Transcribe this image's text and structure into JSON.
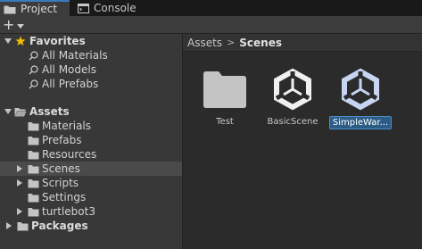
{
  "tabs": [
    {
      "label": "Project",
      "icon": "folder-icon",
      "active": true
    },
    {
      "label": "Console",
      "icon": "console-icon",
      "active": false
    }
  ],
  "toolbar": {
    "add_label": "+"
  },
  "tree": {
    "favorites": {
      "label": "Favorites",
      "items": [
        "All Materials",
        "All Models",
        "All Prefabs"
      ]
    },
    "assets": {
      "label": "Assets",
      "items": [
        "Materials",
        "Prefabs",
        "Resources",
        "Scenes",
        "Scripts",
        "Settings",
        "turtlebot3"
      ]
    },
    "packages": {
      "label": "Packages"
    }
  },
  "breadcrumb": {
    "root": "Assets",
    "separator": ">",
    "current": "Scenes"
  },
  "assets_grid": [
    {
      "label": "Test",
      "type": "folder"
    },
    {
      "label": "BasicScene",
      "type": "scene"
    },
    {
      "label": "SimpleWar...",
      "type": "scene",
      "selected": true
    }
  ],
  "colors": {
    "accent": "#3a79bb",
    "selection": "#2c5d87",
    "favorite_star": "#f4bc02"
  }
}
